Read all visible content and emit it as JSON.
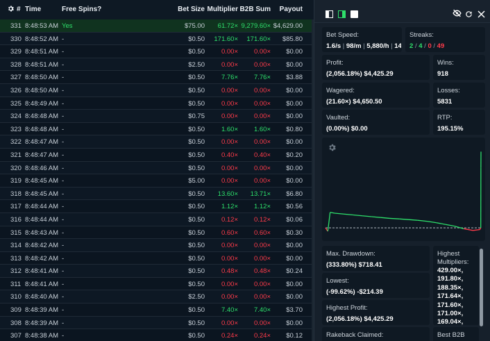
{
  "table": {
    "headers": {
      "id": "#",
      "time": "Time",
      "free_spins": "Free Spins?",
      "bet_size": "Bet Size",
      "multiplier": "Multiplier",
      "b2b_sum": "B2B Sum",
      "payout": "Payout"
    },
    "rows": [
      {
        "id": "331",
        "time": "8:48:53 AM",
        "free_spins": "Yes",
        "bet": "$75.00",
        "mult": "61.72×",
        "b2b": "9,279.60×",
        "payout": "$4,629.00",
        "win": true
      },
      {
        "id": "330",
        "time": "8:48:52 AM",
        "free_spins": "-",
        "bet": "$0.50",
        "mult": "171.60×",
        "b2b": "171.60×",
        "payout": "$85.80",
        "win": true
      },
      {
        "id": "329",
        "time": "8:48:51 AM",
        "free_spins": "-",
        "bet": "$0.50",
        "mult": "0.00×",
        "b2b": "0.00×",
        "payout": "$0.00",
        "win": false
      },
      {
        "id": "328",
        "time": "8:48:51 AM",
        "free_spins": "-",
        "bet": "$2.50",
        "mult": "0.00×",
        "b2b": "0.00×",
        "payout": "$0.00",
        "win": false
      },
      {
        "id": "327",
        "time": "8:48:50 AM",
        "free_spins": "-",
        "bet": "$0.50",
        "mult": "7.76×",
        "b2b": "7.76×",
        "payout": "$3.88",
        "win": true
      },
      {
        "id": "326",
        "time": "8:48:50 AM",
        "free_spins": "-",
        "bet": "$0.50",
        "mult": "0.00×",
        "b2b": "0.00×",
        "payout": "$0.00",
        "win": false
      },
      {
        "id": "325",
        "time": "8:48:49 AM",
        "free_spins": "-",
        "bet": "$0.50",
        "mult": "0.00×",
        "b2b": "0.00×",
        "payout": "$0.00",
        "win": false
      },
      {
        "id": "324",
        "time": "8:48:48 AM",
        "free_spins": "-",
        "bet": "$0.75",
        "mult": "0.00×",
        "b2b": "0.00×",
        "payout": "$0.00",
        "win": false
      },
      {
        "id": "323",
        "time": "8:48:48 AM",
        "free_spins": "-",
        "bet": "$0.50",
        "mult": "1.60×",
        "b2b": "1.60×",
        "payout": "$0.80",
        "win": true
      },
      {
        "id": "322",
        "time": "8:48:47 AM",
        "free_spins": "-",
        "bet": "$0.50",
        "mult": "0.00×",
        "b2b": "0.00×",
        "payout": "$0.00",
        "win": false
      },
      {
        "id": "321",
        "time": "8:48:47 AM",
        "free_spins": "-",
        "bet": "$0.50",
        "mult": "0.40×",
        "b2b": "0.40×",
        "payout": "$0.20",
        "win": false
      },
      {
        "id": "320",
        "time": "8:48:46 AM",
        "free_spins": "-",
        "bet": "$0.50",
        "mult": "0.00×",
        "b2b": "0.00×",
        "payout": "$0.00",
        "win": false
      },
      {
        "id": "319",
        "time": "8:48:45 AM",
        "free_spins": "-",
        "bet": "$5.00",
        "mult": "0.00×",
        "b2b": "0.00×",
        "payout": "$0.00",
        "win": false
      },
      {
        "id": "318",
        "time": "8:48:45 AM",
        "free_spins": "-",
        "bet": "$0.50",
        "mult": "13.60×",
        "b2b": "13.71×",
        "payout": "$6.80",
        "win": true
      },
      {
        "id": "317",
        "time": "8:48:44 AM",
        "free_spins": "-",
        "bet": "$0.50",
        "mult": "1.12×",
        "b2b": "1.12×",
        "payout": "$0.56",
        "win": true
      },
      {
        "id": "316",
        "time": "8:48:44 AM",
        "free_spins": "-",
        "bet": "$0.50",
        "mult": "0.12×",
        "b2b": "0.12×",
        "payout": "$0.06",
        "win": false
      },
      {
        "id": "315",
        "time": "8:48:43 AM",
        "free_spins": "-",
        "bet": "$0.50",
        "mult": "0.60×",
        "b2b": "0.60×",
        "payout": "$0.30",
        "win": false
      },
      {
        "id": "314",
        "time": "8:48:42 AM",
        "free_spins": "-",
        "bet": "$0.50",
        "mult": "0.00×",
        "b2b": "0.00×",
        "payout": "$0.00",
        "win": false
      },
      {
        "id": "313",
        "time": "8:48:42 AM",
        "free_spins": "-",
        "bet": "$0.50",
        "mult": "0.00×",
        "b2b": "0.00×",
        "payout": "$0.00",
        "win": false
      },
      {
        "id": "312",
        "time": "8:48:41 AM",
        "free_spins": "-",
        "bet": "$0.50",
        "mult": "0.48×",
        "b2b": "0.48×",
        "payout": "$0.24",
        "win": false
      },
      {
        "id": "311",
        "time": "8:48:41 AM",
        "free_spins": "-",
        "bet": "$0.50",
        "mult": "0.00×",
        "b2b": "0.00×",
        "payout": "$0.00",
        "win": false
      },
      {
        "id": "310",
        "time": "8:48:40 AM",
        "free_spins": "-",
        "bet": "$2.50",
        "mult": "0.00×",
        "b2b": "0.00×",
        "payout": "$0.00",
        "win": false
      },
      {
        "id": "309",
        "time": "8:48:39 AM",
        "free_spins": "-",
        "bet": "$0.50",
        "mult": "7.40×",
        "b2b": "7.40×",
        "payout": "$3.70",
        "win": true
      },
      {
        "id": "308",
        "time": "8:48:39 AM",
        "free_spins": "-",
        "bet": "$0.50",
        "mult": "0.00×",
        "b2b": "0.00×",
        "payout": "$0.00",
        "win": false
      },
      {
        "id": "307",
        "time": "8:48:38 AM",
        "free_spins": "-",
        "bet": "$0.50",
        "mult": "0.24×",
        "b2b": "0.24×",
        "payout": "$0.12",
        "win": false
      }
    ]
  },
  "stats": {
    "bet_speed": {
      "label": "Bet Speed:",
      "v1": "1.6/s",
      "v2": "98/m",
      "v3": "5,880/h",
      "v4": "14"
    },
    "streaks": {
      "label": "Streaks:",
      "v1": "2",
      "v2": "4",
      "v3": "0",
      "v4": "49"
    },
    "profit": {
      "label": "Profit:",
      "value": "(2,056.18%) $4,425.29"
    },
    "wins": {
      "label": "Wins:",
      "value": "918"
    },
    "wagered": {
      "label": "Wagered:",
      "value": "(21.60×) $4,650.50"
    },
    "losses": {
      "label": "Losses:",
      "value": "5831"
    },
    "vaulted": {
      "label": "Vaulted:",
      "value": "(0.00%) $0.00"
    },
    "rtp": {
      "label": "RTP:",
      "value": "195.15%"
    },
    "max_drawdown": {
      "label": "Max. Drawdown:",
      "value": "(333.80%) $718.41"
    },
    "lowest": {
      "label": "Lowest:",
      "value": "(-99.62%) -$214.39"
    },
    "highest_profit": {
      "label": "Highest Profit:",
      "value": "(2,056.18%) $4,425.29"
    },
    "rakeback": {
      "label": "Rakeback Claimed:"
    },
    "highest_multipliers": {
      "label_1": "Highest",
      "label_2": "Multipliers:",
      "values": [
        "429.00×,",
        "191.80×,",
        "188.35×,",
        "171.64×,",
        "171.60×,",
        "171.00×,",
        "169.04×,"
      ]
    },
    "best_b2b": {
      "label": "Best B2B"
    }
  },
  "colors": {
    "win": "#2ee06b",
    "loss": "#ff3b4a",
    "accent": "#f2c230"
  },
  "icons": {
    "settings": "gear-icon",
    "layout_left": "panel-left-icon",
    "layout_right": "panel-right-icon",
    "layout_full": "square-icon",
    "hide": "eye-off-icon",
    "refresh": "refresh-icon",
    "close": "close-icon"
  },
  "chart_data": {
    "type": "line",
    "x": [
      0,
      100,
      200,
      400,
      800,
      1200,
      1600,
      2000,
      2400,
      2800,
      3200,
      3600,
      4000,
      4400,
      4800,
      5200,
      5600,
      6000,
      6400,
      6700,
      6740,
      6745,
      6749
    ],
    "y": [
      0,
      -200,
      900,
      850,
      800,
      750,
      700,
      650,
      600,
      550,
      520,
      480,
      440,
      380,
      300,
      200,
      100,
      -50,
      -150,
      -100,
      0,
      3500,
      4425.29
    ],
    "ylim": [
      -400,
      4600
    ],
    "xlim": [
      0,
      6749
    ],
    "grid": false,
    "baseline": 0,
    "positive_color": "#2ee06b",
    "negative_color": "#ff3b4a"
  }
}
